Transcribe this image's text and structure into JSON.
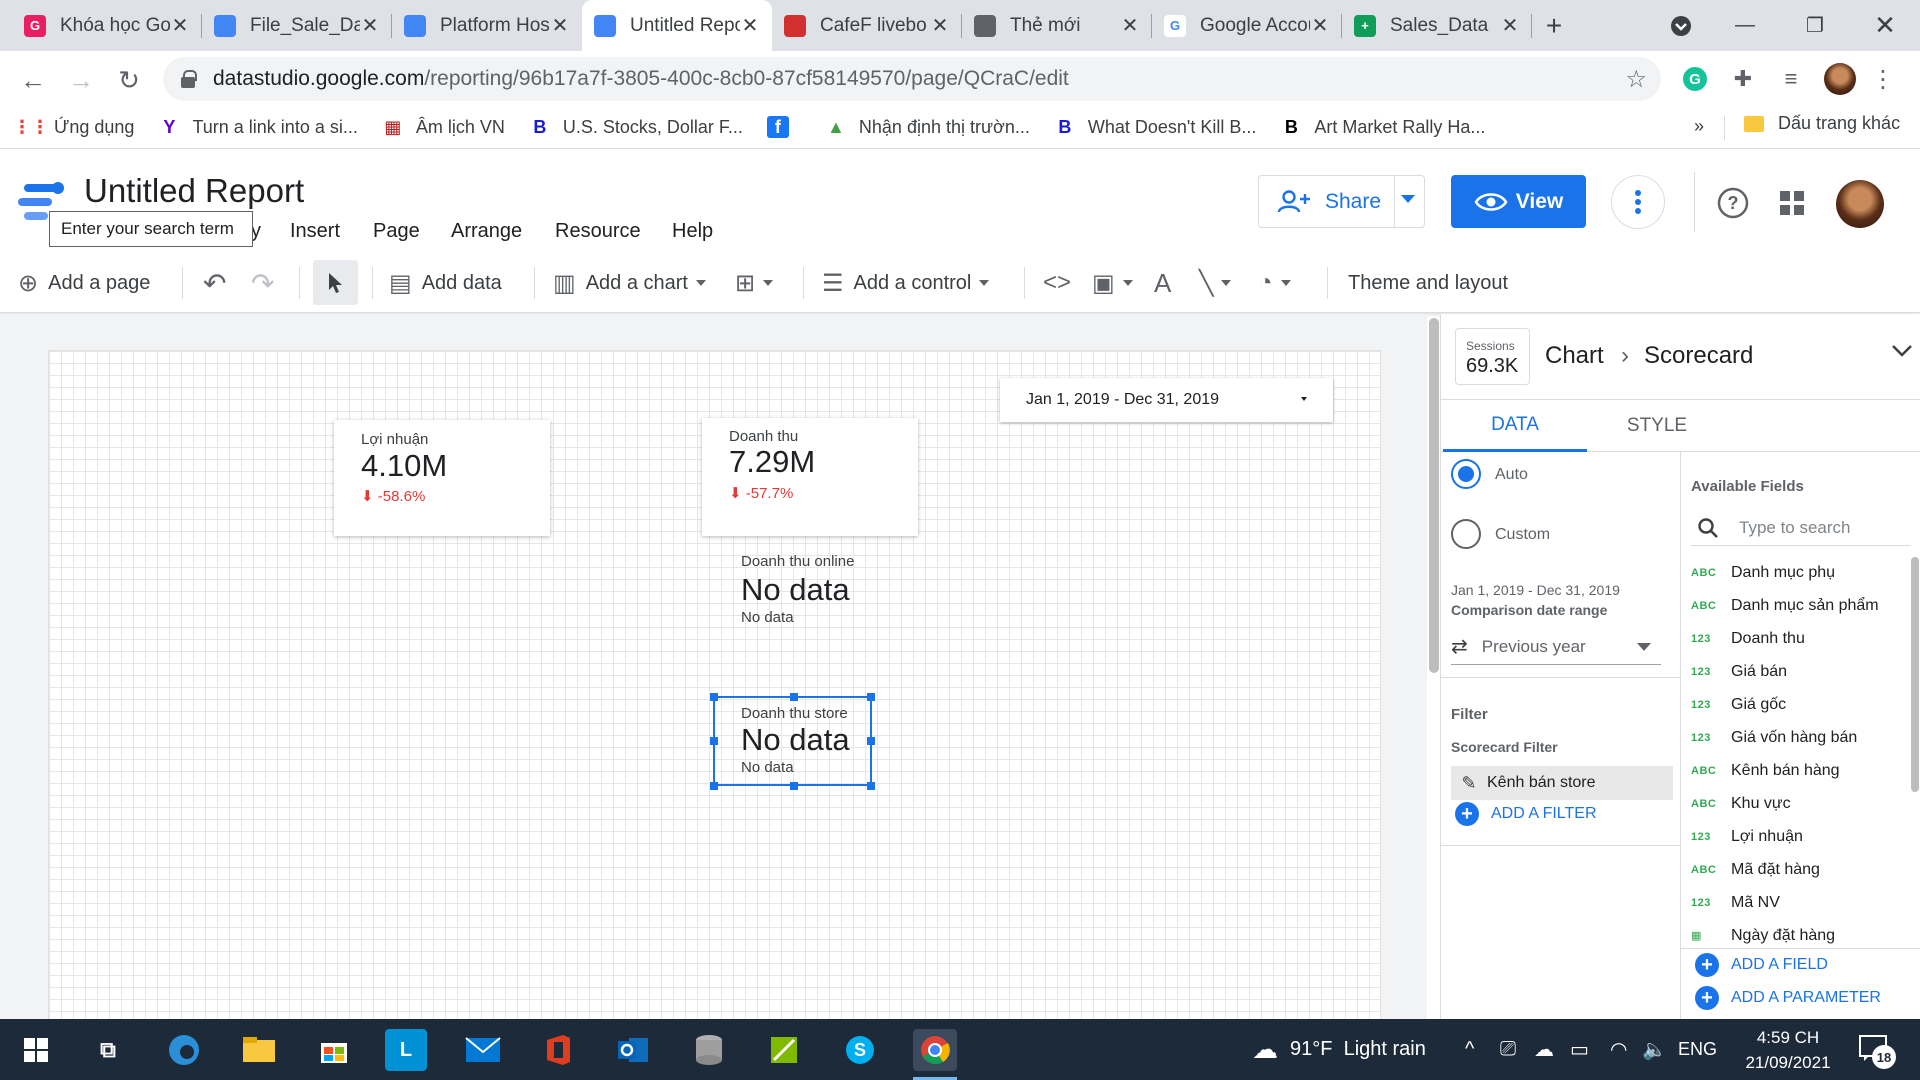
{
  "browser": {
    "tabs": [
      {
        "title": "Khóa học Google",
        "fav_color": "#e91e63",
        "fav_glyph": "G"
      },
      {
        "title": "File_Sale_Data",
        "fav_color": "#4285f4",
        "fav_glyph": ""
      },
      {
        "title": "Platform Hosting",
        "fav_color": "#4285f4",
        "fav_glyph": ""
      },
      {
        "title": "Untitled Report",
        "fav_color": "#4285f4",
        "fav_glyph": ""
      },
      {
        "title": "CafeF livebo",
        "fav_color": "#d32f2f",
        "fav_glyph": ""
      },
      {
        "title": "Thẻ mới",
        "fav_color": "#5f6368",
        "fav_glyph": ""
      },
      {
        "title": "Google Account",
        "fav_color": "#ffffff",
        "fav_glyph": "G"
      },
      {
        "title": "Sales_Data",
        "fav_color": "#0f9d58",
        "fav_glyph": "+"
      }
    ],
    "url_host": "datastudio.google.com",
    "url_path": "/reporting/96b17a7f-3805-400c-8cb0-87cf58149570/page/QCraC/edit",
    "bookmarks": [
      {
        "label": "Ứng dụng",
        "icon": "apps-grid-icon",
        "color": "#ea4335",
        "glyph": "⋮⋮"
      },
      {
        "label": "Turn a link into a si...",
        "icon": "yahoo-icon",
        "color": "#5f01d1",
        "glyph": "Y"
      },
      {
        "label": "Âm lịch VN",
        "icon": "calendar-icon",
        "color": "#b71c1c",
        "glyph": "▦"
      },
      {
        "label": "U.S. Stocks, Dollar F...",
        "icon": "bloomberg-icon",
        "color": "#1a1adb",
        "glyph": "B"
      },
      {
        "label": "",
        "icon": "facebook-icon",
        "color": "#1877f2",
        "glyph": "f"
      },
      {
        "label": "Nhận định thị trườn...",
        "icon": "chart-icon",
        "color": "#43a047",
        "glyph": "▲"
      },
      {
        "label": "What Doesn't Kill B...",
        "icon": "bloomberg-icon",
        "color": "#1a1adb",
        "glyph": "B"
      },
      {
        "label": "Art Market Rally Ha...",
        "icon": "bloomberg-black-icon",
        "color": "#000000",
        "glyph": "B"
      }
    ],
    "other_bookmarks": "Dấu trang khác"
  },
  "header": {
    "title": "Untitled Report",
    "search_tooltip": "Enter your search term",
    "menus": [
      "Insert",
      "Page",
      "Arrange",
      "Resource",
      "Help"
    ],
    "share_label": "Share",
    "view_label": "View"
  },
  "toolbar": {
    "add_page": "Add a page",
    "add_data": "Add data",
    "add_chart": "Add a chart",
    "add_control": "Add a control",
    "theme_layout": "Theme and layout"
  },
  "canvas": {
    "date_range": "Jan 1, 2019 - Dec 31, 2019",
    "scorecards": [
      {
        "label": "Lợi nhuận",
        "value": "4.10M",
        "delta": "-58.6%"
      },
      {
        "label": "Doanh thu",
        "value": "7.29M",
        "delta": "-57.7%"
      },
      {
        "label": "Doanh thu online",
        "value": "No data",
        "sub": "No data"
      },
      {
        "label": "Doanh thu store",
        "value": "No data",
        "sub": "No data"
      }
    ]
  },
  "panel": {
    "chip_label": "Sessions",
    "chip_value": "69.3K",
    "crumb_parent": "Chart",
    "crumb_current": "Scorecard",
    "tab_data": "DATA",
    "tab_style": "STYLE",
    "radio_auto": "Auto",
    "radio_custom": "Custom",
    "comparison_dates": "Jan 1, 2019 - Dec 31, 2019",
    "comparison_label": "Comparison date range",
    "comparison_value": "Previous year",
    "filter_heading": "Filter",
    "scorecard_filter": "Scorecard Filter",
    "filter_name": "Kênh bán store",
    "add_filter": "ADD A FILTER",
    "available_fields": "Available Fields",
    "search_placeholder": "Type to search",
    "fields": [
      {
        "type": "ABC",
        "name": "Danh mục phụ"
      },
      {
        "type": "ABC",
        "name": "Danh mục sản phẩm"
      },
      {
        "type": "123",
        "name": "Doanh thu"
      },
      {
        "type": "123",
        "name": "Giá bán"
      },
      {
        "type": "123",
        "name": "Giá gốc"
      },
      {
        "type": "123",
        "name": "Giá vốn hàng bán"
      },
      {
        "type": "ABC",
        "name": "Kênh bán hàng"
      },
      {
        "type": "ABC",
        "name": "Khu vực"
      },
      {
        "type": "123",
        "name": "Lợi nhuận"
      },
      {
        "type": "ABC",
        "name": "Mã đặt hàng"
      },
      {
        "type": "123",
        "name": "Mã NV"
      },
      {
        "type": "▦",
        "name": "Ngày đặt hàng"
      }
    ],
    "add_field": "ADD A FIELD",
    "add_parameter": "ADD A PARAMETER"
  },
  "taskbar": {
    "weather": "91°F",
    "weather_desc": "Light rain",
    "lang": "ENG",
    "time": "4:59 CH",
    "date": "21/09/2021",
    "notif_count": "18"
  }
}
